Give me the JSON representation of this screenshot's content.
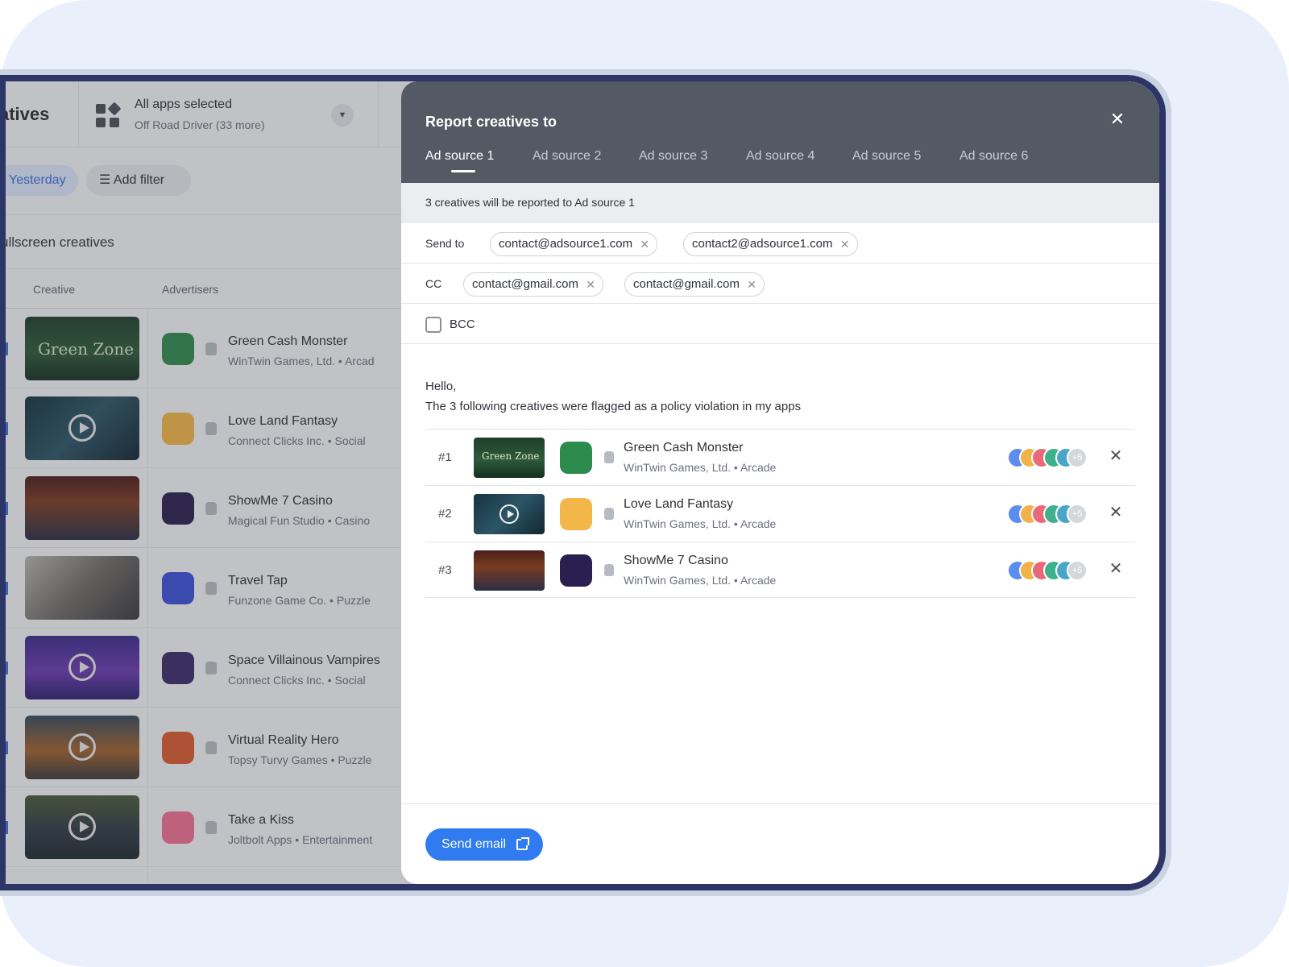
{
  "header": {
    "page_title": "atives",
    "apps_selector": {
      "title": "All apps selected",
      "subtitle": "Off Road Driver (33 more)"
    }
  },
  "filters": {
    "date": "Yesterday",
    "add_filter": "Add filter"
  },
  "section_title": "ullscreen creatives",
  "columns": {
    "creative": "Creative",
    "advertisers": "Advertisers"
  },
  "rows": [
    {
      "name": "Green Cash Monster",
      "sub": "WinTwin Games, Ltd. • Arcad",
      "thumb_text": "Green Zone"
    },
    {
      "name": "Love Land Fantasy",
      "sub": "Connect Clicks Inc. • Social"
    },
    {
      "name": "ShowMe 7 Casino",
      "sub": "Magical Fun Studio • Casino"
    },
    {
      "name": "Travel Tap",
      "sub": "Funzone Game Co. • Puzzle"
    },
    {
      "name": "Space Villainous Vampires",
      "sub": "Connect Clicks Inc. • Social"
    },
    {
      "name": "Virtual Reality Hero",
      "sub": "Topsy Turvy Games • Puzzle"
    },
    {
      "name": "Take a Kiss",
      "sub": "Joltbolt Apps • Entertainment"
    }
  ],
  "modal": {
    "title": "Report creatives to",
    "close": "✕",
    "tabs": [
      "Ad source 1",
      "Ad source 2",
      "Ad source 3",
      "Ad source 4",
      "Ad source 5",
      "Ad source 6"
    ],
    "info": "3 creatives will be reported to Ad source 1",
    "send_to_label": "Send to",
    "send_to": [
      "contact@adsource1.com",
      "contact2@adsource1.com"
    ],
    "cc_label": "CC",
    "cc": [
      "contact@gmail.com",
      "contact@gmail.com"
    ],
    "bcc_label": "BCC",
    "chip_remove": "✕",
    "greeting": "Hello,",
    "body": "The 3 following creatives were flagged as a policy violation in my apps",
    "creatives": [
      {
        "num": "#1",
        "name": "Green Cash Monster",
        "sub": "WinTwin Games, Ltd. • Arcade",
        "more": "+5",
        "thumb_text": "Green Zone"
      },
      {
        "num": "#2",
        "name": "Love Land Fantasy",
        "sub": "WinTwin Games, Ltd. • Arcade",
        "more": "+5"
      },
      {
        "num": "#3",
        "name": "ShowMe 7 Casino",
        "sub": "WinTwin Games, Ltd. • Arcade",
        "more": "+5"
      }
    ],
    "remove": "✕",
    "send_button": "Send email"
  },
  "colors": {
    "accent": "#2f7bef",
    "header": "#545a63",
    "device_bezel": "#2c3566"
  }
}
